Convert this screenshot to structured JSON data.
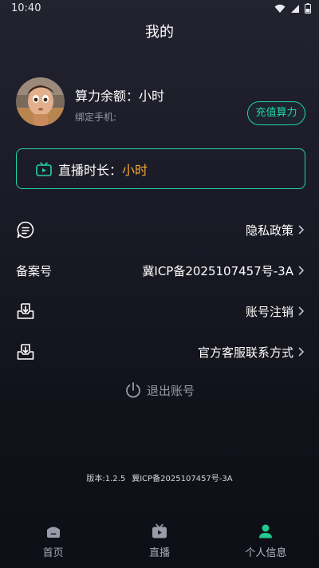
{
  "status_bar": {
    "time": "10:40"
  },
  "header": {
    "title": "我的"
  },
  "profile": {
    "balance_label": "算力余额：",
    "balance_value": "小时",
    "phone_label": "绑定手机:",
    "recharge_label": "充值算力"
  },
  "live_card": {
    "label": "直播时长：",
    "value": "小时"
  },
  "menu": {
    "privacy_label": "隐私政策",
    "record_left_label": "备案号",
    "record_value": "冀ICP备2025107457号-3A",
    "account_cancel_label": "账号注销",
    "support_label": "官方客服联系方式"
  },
  "logout": {
    "label": "退出账号"
  },
  "footer": {
    "version": "版本:1.2.5",
    "icp": "冀ICP备2025107457号-3A"
  },
  "bottom_nav": {
    "home": "首页",
    "live": "直播",
    "profile": "个人信息"
  },
  "colors": {
    "accent": "#22d3a6",
    "highlight": "#f4a935",
    "background": "#14141f"
  }
}
